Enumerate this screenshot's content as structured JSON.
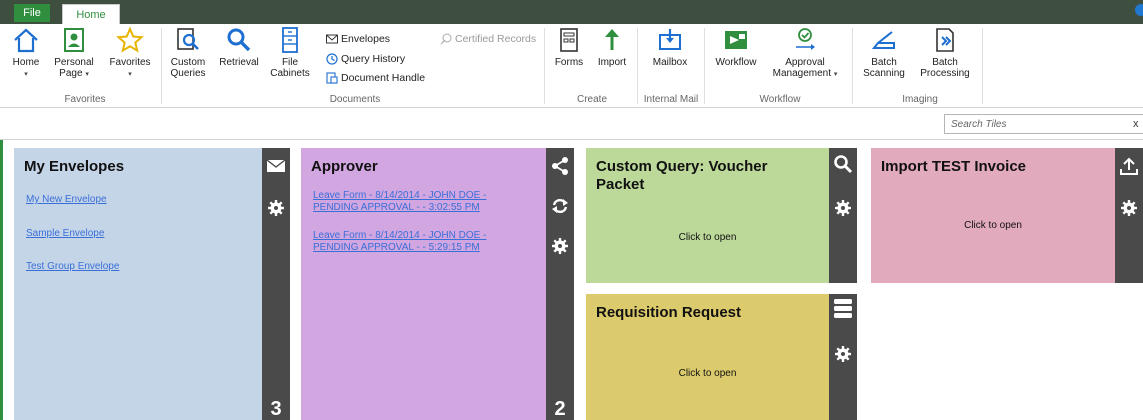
{
  "tabs": {
    "file": "File",
    "home": "Home"
  },
  "ribbon": {
    "favorites": {
      "home": "Home",
      "personal_page_line1": "Personal",
      "personal_page_line2": "Page",
      "favorites": "Favorites",
      "group": "Favorites"
    },
    "documents": {
      "custom_queries_line1": "Custom",
      "custom_queries_line2": "Queries",
      "retrieval": "Retrieval",
      "file_cabinets_line1": "File",
      "file_cabinets_line2": "Cabinets",
      "envelopes": "Envelopes",
      "query_history": "Query History",
      "document_handle": "Document Handle",
      "certified_records": "Certified Records",
      "group": "Documents"
    },
    "create": {
      "forms": "Forms",
      "import": "Import",
      "group": "Create"
    },
    "internal_mail": {
      "mailbox": "Mailbox",
      "group": "Internal Mail"
    },
    "workflow": {
      "workflow": "Workflow",
      "approval_line1": "Approval",
      "approval_line2": "Management",
      "group": "Workflow"
    },
    "imaging": {
      "batch_scanning_line1": "Batch",
      "batch_scanning_line2": "Scanning",
      "batch_processing_line1": "Batch",
      "batch_processing_line2": "Processing",
      "group": "Imaging"
    }
  },
  "search": {
    "placeholder": "Search Tiles",
    "close": "x"
  },
  "tiles": {
    "my_envelopes": {
      "title": "My Envelopes",
      "links": [
        "My New Envelope",
        "Sample Envelope",
        "Test Group Envelope"
      ],
      "count": "3"
    },
    "approver": {
      "title": "Approver",
      "links": [
        {
          "line1": "Leave Form - 8/14/2014 - JOHN DOE -",
          "line2": "PENDING APPROVAL -  - 3:02:55 PM"
        },
        {
          "line1": "Leave Form - 8/14/2014 - JOHN DOE -",
          "line2": "PENDING APPROVAL -  - 5:29:15 PM"
        }
      ],
      "count": "2"
    },
    "custom_query": {
      "title_line1": "Custom Query: Voucher",
      "title_line2": "Packet",
      "open": "Click to open"
    },
    "import_invoice": {
      "title": "Import TEST Invoice",
      "open": "Click to open"
    },
    "requisition": {
      "title": "Requisition Request",
      "open": "Click to open"
    }
  },
  "colors": {
    "accent_green": "#2f8f3f",
    "tile_envelopes": "#c5d5e8",
    "tile_approver": "#d2a6e0",
    "tile_custom_query": "#bcd99a",
    "tile_import": "#e2aabd",
    "tile_requisition": "#dccb6c",
    "rail": "#4a4a4a",
    "link": "#3a6fd8"
  },
  "icons": {
    "home": "home-icon",
    "personal_page": "person-icon",
    "favorites": "star-icon",
    "custom_queries": "document-search-icon",
    "retrieval": "magnifier-icon",
    "file_cabinets": "cabinet-icon",
    "envelopes": "envelope-icon",
    "query_history": "clock-icon",
    "document_handle": "document-handle-icon",
    "certified_records": "certified-icon",
    "forms": "forms-icon",
    "import": "arrow-up-icon",
    "mailbox": "mailbox-icon",
    "workflow": "workflow-icon",
    "approval": "approval-icon",
    "batch_scanning": "scanner-icon",
    "batch_processing": "batch-processing-icon"
  }
}
